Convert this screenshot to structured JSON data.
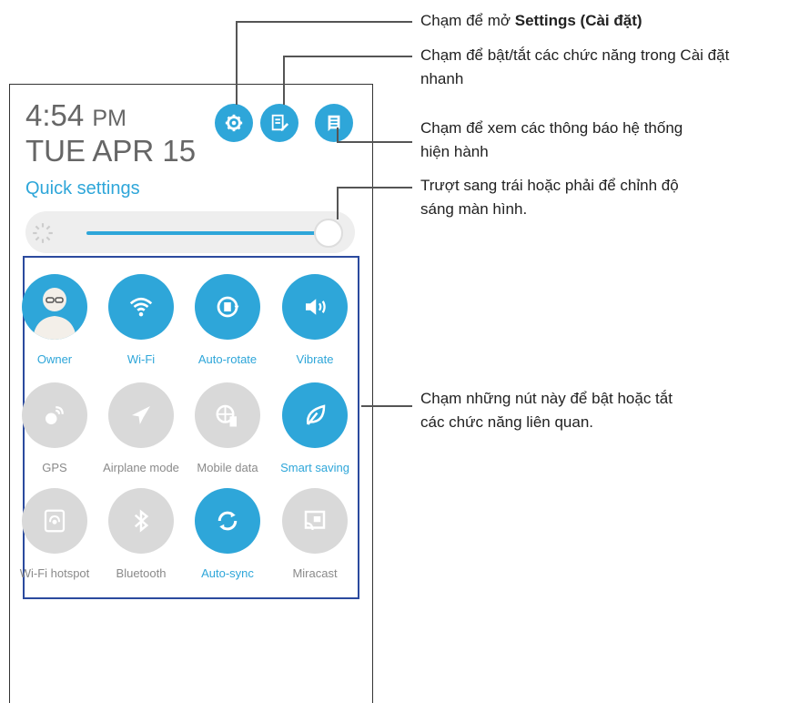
{
  "status": {
    "time": "4:54",
    "ampm": "PM",
    "date": "TUE APR 15",
    "quick_settings_label": "Quick settings"
  },
  "top_buttons": [
    {
      "name": "settings-gear-icon"
    },
    {
      "name": "edit-quick-settings-icon"
    },
    {
      "name": "notifications-list-icon"
    }
  ],
  "brightness": {
    "level": 0.95
  },
  "tiles": [
    {
      "label": "Owner",
      "state": "on",
      "icon": "user-avatar-icon"
    },
    {
      "label": "Wi-Fi",
      "state": "on",
      "icon": "wifi-icon"
    },
    {
      "label": "Auto-rotate",
      "state": "on",
      "icon": "auto-rotate-icon"
    },
    {
      "label": "Vibrate",
      "state": "on",
      "icon": "vibrate-icon"
    },
    {
      "label": "GPS",
      "state": "off",
      "icon": "gps-icon"
    },
    {
      "label": "Airplane mode",
      "state": "off",
      "icon": "airplane-icon"
    },
    {
      "label": "Mobile data",
      "state": "off",
      "icon": "mobile-data-icon"
    },
    {
      "label": "Smart saving",
      "state": "on",
      "icon": "leaf-icon"
    },
    {
      "label": "Wi-Fi hotspot",
      "state": "off",
      "icon": "hotspot-icon"
    },
    {
      "label": "Bluetooth",
      "state": "off",
      "icon": "bluetooth-icon"
    },
    {
      "label": "Auto-sync",
      "state": "on",
      "icon": "sync-icon"
    },
    {
      "label": "Miracast",
      "state": "off",
      "icon": "cast-icon"
    }
  ],
  "callouts": {
    "settings_prefix": "Chạm để mở ",
    "settings_bold": "Settings (Cài đặt)",
    "edit_line1": "Chạm để bật/tắt các chức năng trong Cài đặt",
    "edit_line2": "nhanh",
    "notif_line1": "Chạm để xem các thông báo hệ thống",
    "notif_line2": "hiện hành",
    "bright_line1": "Trượt sang trái hoặc phải để chỉnh độ",
    "bright_line2": "sáng màn hình.",
    "tiles_line1": "Chạm những nút này để bật hoặc tắt",
    "tiles_line2": "các chức năng liên quan."
  },
  "colors": {
    "accent": "#2ea6d9",
    "inactive": "#d9d9d9",
    "box": "#2b4a9e"
  }
}
